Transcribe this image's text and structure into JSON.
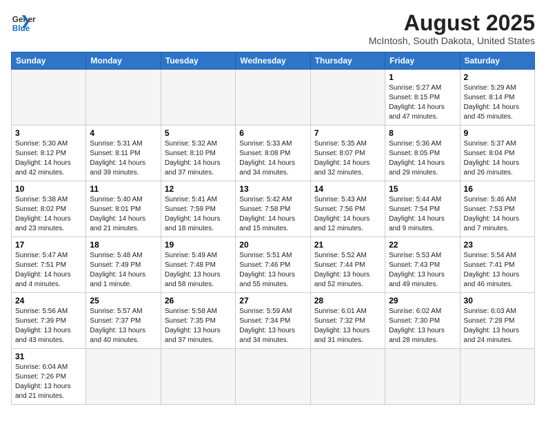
{
  "header": {
    "logo_general": "General",
    "logo_blue": "Blue",
    "title": "August 2025",
    "subtitle": "McIntosh, South Dakota, United States"
  },
  "weekdays": [
    "Sunday",
    "Monday",
    "Tuesday",
    "Wednesday",
    "Thursday",
    "Friday",
    "Saturday"
  ],
  "weeks": [
    [
      {
        "day": "",
        "info": "",
        "empty": true
      },
      {
        "day": "",
        "info": "",
        "empty": true
      },
      {
        "day": "",
        "info": "",
        "empty": true
      },
      {
        "day": "",
        "info": "",
        "empty": true
      },
      {
        "day": "",
        "info": "",
        "empty": true
      },
      {
        "day": "1",
        "info": "Sunrise: 5:27 AM\nSunset: 8:15 PM\nDaylight: 14 hours and 47 minutes."
      },
      {
        "day": "2",
        "info": "Sunrise: 5:29 AM\nSunset: 8:14 PM\nDaylight: 14 hours and 45 minutes."
      }
    ],
    [
      {
        "day": "3",
        "info": "Sunrise: 5:30 AM\nSunset: 8:12 PM\nDaylight: 14 hours and 42 minutes."
      },
      {
        "day": "4",
        "info": "Sunrise: 5:31 AM\nSunset: 8:11 PM\nDaylight: 14 hours and 39 minutes."
      },
      {
        "day": "5",
        "info": "Sunrise: 5:32 AM\nSunset: 8:10 PM\nDaylight: 14 hours and 37 minutes."
      },
      {
        "day": "6",
        "info": "Sunrise: 5:33 AM\nSunset: 8:08 PM\nDaylight: 14 hours and 34 minutes."
      },
      {
        "day": "7",
        "info": "Sunrise: 5:35 AM\nSunset: 8:07 PM\nDaylight: 14 hours and 32 minutes."
      },
      {
        "day": "8",
        "info": "Sunrise: 5:36 AM\nSunset: 8:05 PM\nDaylight: 14 hours and 29 minutes."
      },
      {
        "day": "9",
        "info": "Sunrise: 5:37 AM\nSunset: 8:04 PM\nDaylight: 14 hours and 26 minutes."
      }
    ],
    [
      {
        "day": "10",
        "info": "Sunrise: 5:38 AM\nSunset: 8:02 PM\nDaylight: 14 hours and 23 minutes."
      },
      {
        "day": "11",
        "info": "Sunrise: 5:40 AM\nSunset: 8:01 PM\nDaylight: 14 hours and 21 minutes."
      },
      {
        "day": "12",
        "info": "Sunrise: 5:41 AM\nSunset: 7:59 PM\nDaylight: 14 hours and 18 minutes."
      },
      {
        "day": "13",
        "info": "Sunrise: 5:42 AM\nSunset: 7:58 PM\nDaylight: 14 hours and 15 minutes."
      },
      {
        "day": "14",
        "info": "Sunrise: 5:43 AM\nSunset: 7:56 PM\nDaylight: 14 hours and 12 minutes."
      },
      {
        "day": "15",
        "info": "Sunrise: 5:44 AM\nSunset: 7:54 PM\nDaylight: 14 hours and 9 minutes."
      },
      {
        "day": "16",
        "info": "Sunrise: 5:46 AM\nSunset: 7:53 PM\nDaylight: 14 hours and 7 minutes."
      }
    ],
    [
      {
        "day": "17",
        "info": "Sunrise: 5:47 AM\nSunset: 7:51 PM\nDaylight: 14 hours and 4 minutes."
      },
      {
        "day": "18",
        "info": "Sunrise: 5:48 AM\nSunset: 7:49 PM\nDaylight: 14 hours and 1 minute."
      },
      {
        "day": "19",
        "info": "Sunrise: 5:49 AM\nSunset: 7:48 PM\nDaylight: 13 hours and 58 minutes."
      },
      {
        "day": "20",
        "info": "Sunrise: 5:51 AM\nSunset: 7:46 PM\nDaylight: 13 hours and 55 minutes."
      },
      {
        "day": "21",
        "info": "Sunrise: 5:52 AM\nSunset: 7:44 PM\nDaylight: 13 hours and 52 minutes."
      },
      {
        "day": "22",
        "info": "Sunrise: 5:53 AM\nSunset: 7:43 PM\nDaylight: 13 hours and 49 minutes."
      },
      {
        "day": "23",
        "info": "Sunrise: 5:54 AM\nSunset: 7:41 PM\nDaylight: 13 hours and 46 minutes."
      }
    ],
    [
      {
        "day": "24",
        "info": "Sunrise: 5:56 AM\nSunset: 7:39 PM\nDaylight: 13 hours and 43 minutes."
      },
      {
        "day": "25",
        "info": "Sunrise: 5:57 AM\nSunset: 7:37 PM\nDaylight: 13 hours and 40 minutes."
      },
      {
        "day": "26",
        "info": "Sunrise: 5:58 AM\nSunset: 7:35 PM\nDaylight: 13 hours and 37 minutes."
      },
      {
        "day": "27",
        "info": "Sunrise: 5:59 AM\nSunset: 7:34 PM\nDaylight: 13 hours and 34 minutes."
      },
      {
        "day": "28",
        "info": "Sunrise: 6:01 AM\nSunset: 7:32 PM\nDaylight: 13 hours and 31 minutes."
      },
      {
        "day": "29",
        "info": "Sunrise: 6:02 AM\nSunset: 7:30 PM\nDaylight: 13 hours and 28 minutes."
      },
      {
        "day": "30",
        "info": "Sunrise: 6:03 AM\nSunset: 7:28 PM\nDaylight: 13 hours and 24 minutes."
      }
    ],
    [
      {
        "day": "31",
        "info": "Sunrise: 6:04 AM\nSunset: 7:26 PM\nDaylight: 13 hours and 21 minutes."
      },
      {
        "day": "",
        "info": "",
        "empty": true
      },
      {
        "day": "",
        "info": "",
        "empty": true
      },
      {
        "day": "",
        "info": "",
        "empty": true
      },
      {
        "day": "",
        "info": "",
        "empty": true
      },
      {
        "day": "",
        "info": "",
        "empty": true
      },
      {
        "day": "",
        "info": "",
        "empty": true
      }
    ]
  ]
}
